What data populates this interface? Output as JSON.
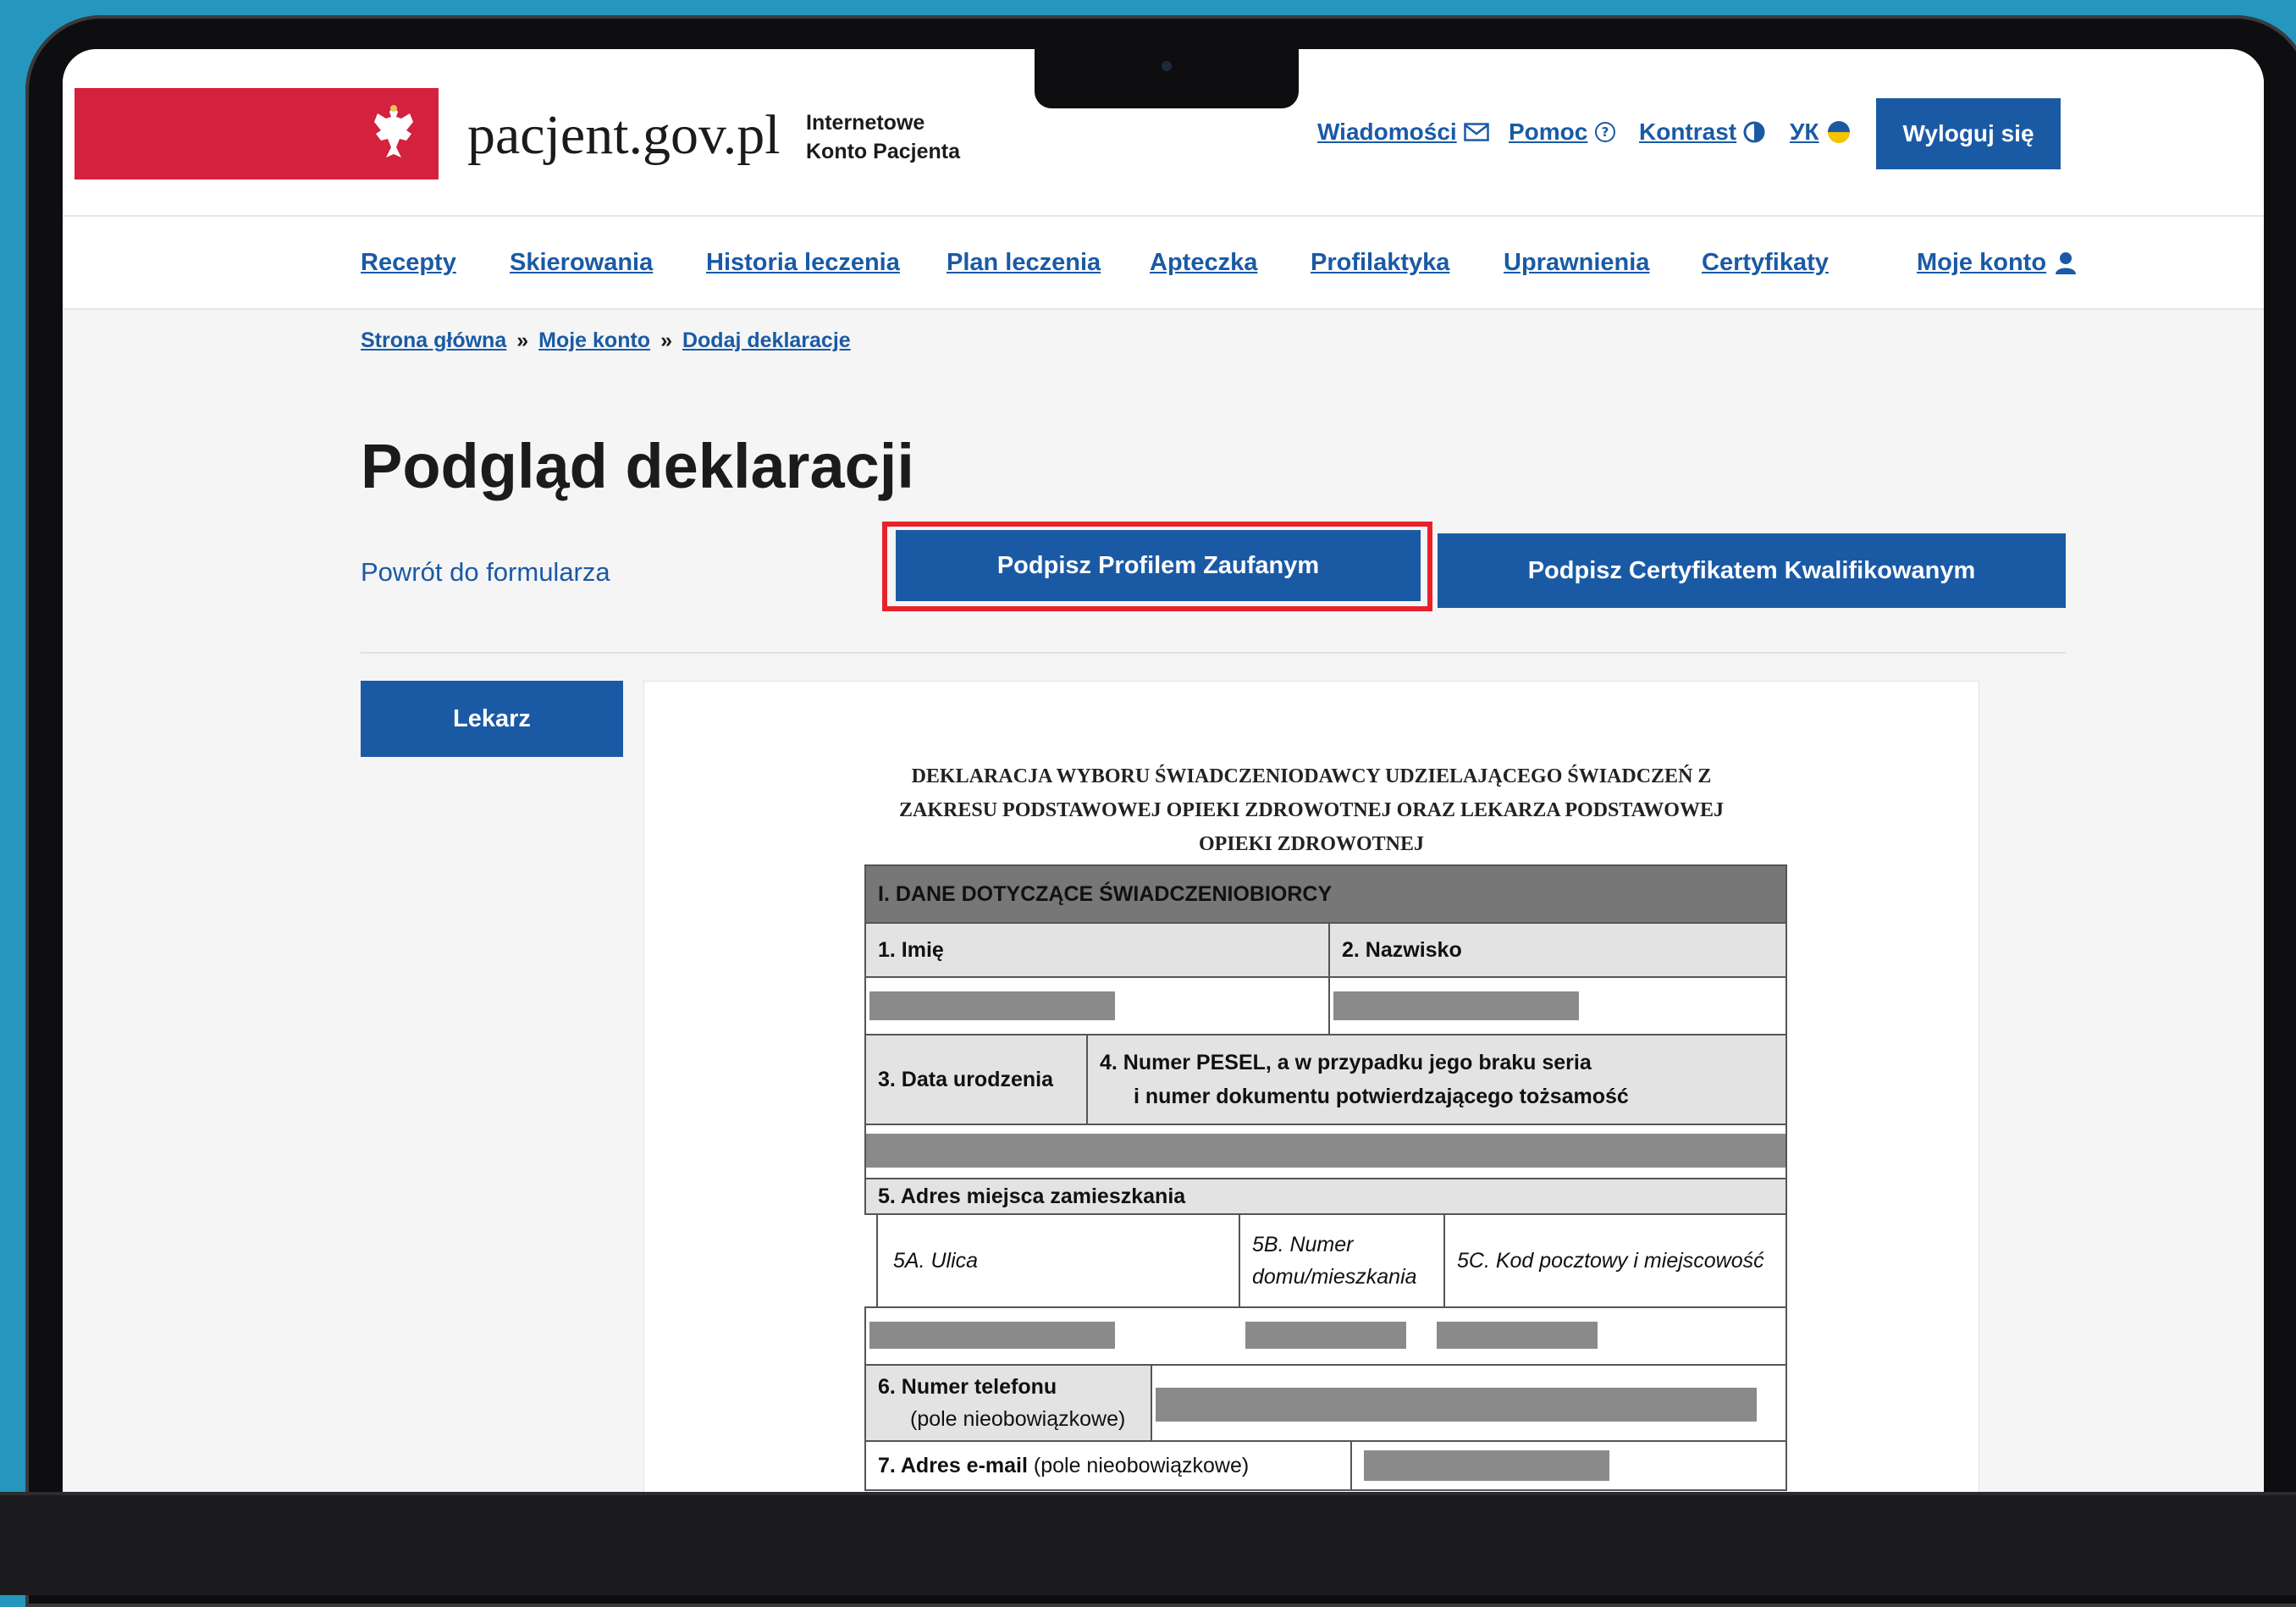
{
  "header": {
    "logo_text": "pacjent.gov.pl",
    "logo_sub_line1": "Internetowe",
    "logo_sub_line2": "Konto Pacjenta",
    "messages": "Wiadomości",
    "help": "Pomoc",
    "contrast": "Kontrast",
    "language": "УК",
    "logout": "Wyloguj się"
  },
  "nav": {
    "items": [
      "Recepty",
      "Skierowania",
      "Historia leczenia",
      "Plan leczenia",
      "Apteczka",
      "Profilaktyka",
      "Uprawnienia",
      "Certyfikaty"
    ],
    "account": "Moje konto"
  },
  "breadcrumb": {
    "home": "Strona główna",
    "account": "Moje konto",
    "current": "Dodaj deklaracje",
    "separator": "»"
  },
  "page": {
    "title": "Podgląd deklaracji",
    "back_link": "Powrót do formularza",
    "sign_trusted": "Podpisz Profilem Zaufanym",
    "sign_qualified": "Podpisz Certyfikatem Kwalifikowanym",
    "doctor_tab": "Lekarz"
  },
  "document": {
    "title_line1": "DEKLARACJA WYBORU ŚWIADCZENIODAWCY UDZIELAJĄCEGO ŚWIADCZEŃ Z",
    "title_line2": "ZAKRESU PODSTAWOWEJ OPIEKI ZDROWOTNEJ ORAZ LEKARZA PODSTAWOWEJ",
    "title_line3": "OPIEKI ZDROWOTNEJ",
    "section1": "I.   DANE DOTYCZĄCE ŚWIADCZENIOBIORCY",
    "first_name": "1.  Imię",
    "last_name": "2.  Nazwisko",
    "birth_date": "3.  Data urodzenia",
    "pesel_line1": "4.  Numer PESEL, a w przypadku jego braku seria",
    "pesel_line2": "i numer dokumentu potwierdzającego tożsamość",
    "address": "5.  Adres miejsca zamieszkania",
    "street": "5A. Ulica",
    "house_line1": "5B. Numer",
    "house_line2": "domu/mieszkania",
    "postal": "5C. Kod pocztowy i miejscowość",
    "phone": "6.  Numer telefonu",
    "phone_note": "(pole nieobowiązkowe)",
    "email": "7.  Adres e-mail",
    "email_note": "(pole nieobowiązkowe)"
  },
  "colors": {
    "brand_blue": "#1a5aa5",
    "flag_red": "#d4213d",
    "highlight_red": "#e8222b",
    "background": "#2596be"
  }
}
